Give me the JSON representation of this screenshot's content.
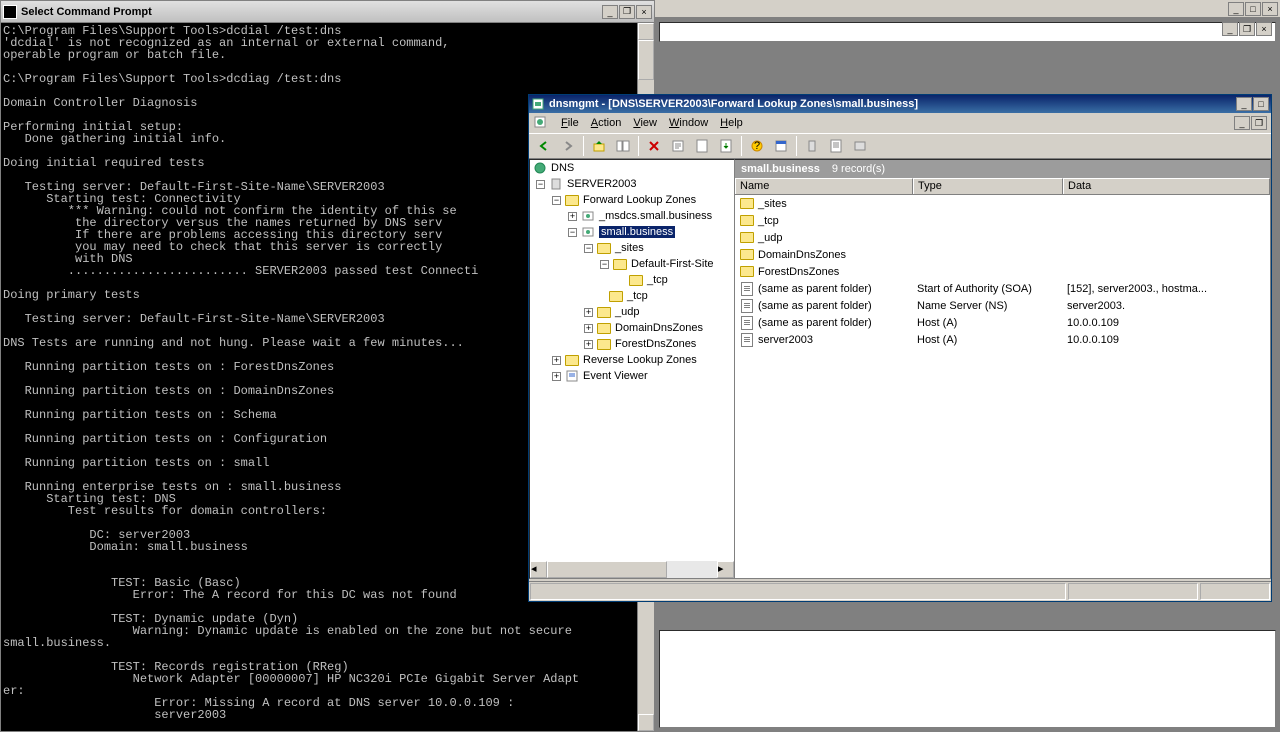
{
  "cmd": {
    "title": "Select Command Prompt",
    "text": "C:\\Program Files\\Support Tools>dcdial /test:dns\n'dcdial' is not recognized as an internal or external command,\noperable program or batch file.\n\nC:\\Program Files\\Support Tools>dcdiag /test:dns\n\nDomain Controller Diagnosis\n\nPerforming initial setup:\n   Done gathering initial info.\n\nDoing initial required tests\n\n   Testing server: Default-First-Site-Name\\SERVER2003\n      Starting test: Connectivity\n         *** Warning: could not confirm the identity of this se\n          the directory versus the names returned by DNS serv\n          If there are problems accessing this directory serv\n          you may need to check that this server is correctly\n          with DNS\n         ......................... SERVER2003 passed test Connecti\n\nDoing primary tests\n\n   Testing server: Default-First-Site-Name\\SERVER2003\n\nDNS Tests are running and not hung. Please wait a few minutes...\n\n   Running partition tests on : ForestDnsZones\n\n   Running partition tests on : DomainDnsZones\n\n   Running partition tests on : Schema\n\n   Running partition tests on : Configuration\n\n   Running partition tests on : small\n\n   Running enterprise tests on : small.business\n      Starting test: DNS\n         Test results for domain controllers:\n\n            DC: server2003\n            Domain: small.business\n\n\n               TEST: Basic (Basc)\n                  Error: The A record for this DC was not found\n\n               TEST: Dynamic update (Dyn)\n                  Warning: Dynamic update is enabled on the zone but not secure\nsmall.business.\n\n               TEST: Records registration (RReg)\n                  Network Adapter [00000007] HP NC320i PCIe Gigabit Server Adapt\ner:\n                     Error: Missing A record at DNS server 10.0.0.109 :\n                     server2003"
  },
  "dns": {
    "title": "dnsmgmt - [DNS\\SERVER2003\\Forward Lookup Zones\\small.business]",
    "menu": {
      "file": "File",
      "action": "Action",
      "view": "View",
      "window": "Window",
      "help": "Help"
    },
    "tree": {
      "root": "DNS",
      "server": "SERVER2003",
      "flz": "Forward Lookup Zones",
      "msdcs": "_msdcs.small.business",
      "small": "small.business",
      "sites": "_sites",
      "dfs": "Default-First-Site",
      "tcp1": "_tcp",
      "tcp2": "_tcp",
      "udp": "_udp",
      "ddz": "DomainDnsZones",
      "fdz": "ForestDnsZones",
      "rlz": "Reverse Lookup Zones",
      "ev": "Event Viewer"
    },
    "list": {
      "header": "small.business",
      "count": "9 record(s)",
      "cols": {
        "name": "Name",
        "type": "Type",
        "data": "Data"
      },
      "rows": [
        {
          "name": "_sites",
          "type": "",
          "data": "",
          "icon": "folder"
        },
        {
          "name": "_tcp",
          "type": "",
          "data": "",
          "icon": "folder"
        },
        {
          "name": "_udp",
          "type": "",
          "data": "",
          "icon": "folder"
        },
        {
          "name": "DomainDnsZones",
          "type": "",
          "data": "",
          "icon": "folder"
        },
        {
          "name": "ForestDnsZones",
          "type": "",
          "data": "",
          "icon": "folder"
        },
        {
          "name": "(same as parent folder)",
          "type": "Start of Authority (SOA)",
          "data": "[152], server2003., hostma...",
          "icon": "record"
        },
        {
          "name": "(same as parent folder)",
          "type": "Name Server (NS)",
          "data": "server2003.",
          "icon": "record"
        },
        {
          "name": "(same as parent folder)",
          "type": "Host (A)",
          "data": "10.0.0.109",
          "icon": "record"
        },
        {
          "name": "server2003",
          "type": "Host (A)",
          "data": "10.0.0.109",
          "icon": "record"
        }
      ]
    }
  }
}
